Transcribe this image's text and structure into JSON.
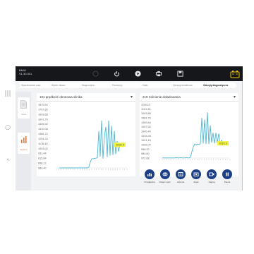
{
  "header": {
    "vehicle_make": "BMW",
    "vehicle_version": "V1.30.001"
  },
  "top_icons": [
    "home-icon",
    "power-icon",
    "play-icon",
    "print-icon",
    "save-icon"
  ],
  "breadcrumbs": [
    {
      "label": "Wyszukiwanie auta",
      "active": false
    },
    {
      "label": "Wybór układu",
      "active": false
    },
    {
      "label": "Diagnostyka",
      "active": false
    },
    {
      "label": "Parametry",
      "active": false
    },
    {
      "label": "Zapis",
      "active": false
    },
    {
      "label": "Odczyty dodatkowe",
      "active": false
    },
    {
      "label": "Odczyty diagnostyczne",
      "active": true
    }
  ],
  "sidebar": {
    "items": [
      {
        "label": "Tekst",
        "icon": "document-icon"
      },
      {
        "label": "Wykres",
        "icon": "chart-icon"
      }
    ]
  },
  "colors": {
    "line": "#4ab8d6",
    "marker": "#eef23a",
    "accent": "#1d3f86",
    "topbar": "#16171b"
  },
  "panels": [
    {
      "title": "101 prędkość obrotowa silnika",
      "value_label": "1030.5",
      "chart_data": {
        "type": "line",
        "y_ticks": [
          "1815,52",
          "1757,60",
          "1699,68",
          "1641,76",
          "1525,92",
          "1410,08",
          "1386,72",
          "1294,24",
          "1178,40",
          "1003,00",
          "931,44",
          "815,84",
          "698,12",
          "580,40"
        ],
        "ylim": [
          580.4,
          1815.52
        ],
        "values": [
          580,
          580,
          581,
          580,
          580,
          581,
          580,
          580,
          580,
          581,
          580,
          580,
          582,
          600,
          700,
          760,
          760,
          765,
          770,
          780,
          1300,
          800,
          1500,
          760,
          1200,
          1380,
          790,
          1500,
          820,
          1400,
          830,
          1300,
          850,
          1100,
          900,
          1030,
          1030
        ]
      }
    },
    {
      "title": "219 Ciśnienie doładowania",
      "value_label": "1010.3",
      "chart_data": {
        "type": "line",
        "y_ticks": [
          "1116,12",
          "1101,96",
          "1093,88",
          "1081,76",
          "1069,64",
          "1057,52",
          "1045,40",
          "1033,28",
          "1021,16",
          "1009,04",
          "996,92",
          "984,80",
          "972,68"
        ],
        "ylim": [
          972.68,
          1116.12
        ],
        "values": [
          973,
          973,
          974,
          973,
          973,
          974,
          973,
          973,
          973,
          974,
          973,
          973,
          975,
          990,
          1003,
          1010,
          1008,
          1010,
          1009,
          1011,
          1080,
          1012,
          1075,
          1010,
          1095,
          1010,
          1060,
          1014,
          1040,
          1012,
          1040,
          1013,
          1038,
          1012,
          1020,
          1014,
          1012
        ]
      }
    }
  ],
  "actions": [
    {
      "label": "Podgląd/ca",
      "icon": "bar-chart-icon"
    },
    {
      "label": "Połącz wykr.",
      "icon": "link-icon"
    },
    {
      "label": "Historia",
      "icon": "history-icon"
    },
    {
      "label": "Zapis",
      "icon": "camera-icon"
    },
    {
      "label": "Nagraj",
      "icon": "record-icon"
    },
    {
      "label": "Pauza",
      "icon": "pause-icon"
    }
  ]
}
